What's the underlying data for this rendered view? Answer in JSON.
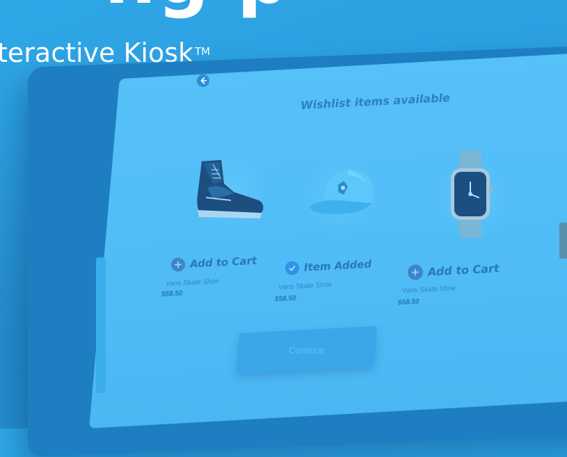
{
  "headline": {
    "text": "ng p"
  },
  "subheading": {
    "text": "teractive Kiosk",
    "trademark": "TM"
  },
  "kiosk": {
    "back_icon": "arrow-left-icon",
    "title": "Wishlist items available",
    "products": [
      {
        "image": "sneaker",
        "action_label": "Add to Cart",
        "action_icon": "plus-icon",
        "action_state": "add",
        "name": "Vans Skate Shoe",
        "price": "$58.50"
      },
      {
        "image": "cap",
        "action_label": "Item Added",
        "action_icon": "check-icon",
        "action_state": "added",
        "name": "Vans Skate Shoe",
        "price": "$58.50"
      },
      {
        "image": "smartwatch",
        "action_label": "Add to Cart",
        "action_icon": "plus-icon",
        "action_state": "add",
        "name": "Vans Skate Shoe",
        "price": "$58.50"
      }
    ],
    "continue_label": "Continue"
  },
  "colors": {
    "background": "#2ba2e2",
    "screen": "#52bef7",
    "text_dark": "#2a78b9"
  }
}
